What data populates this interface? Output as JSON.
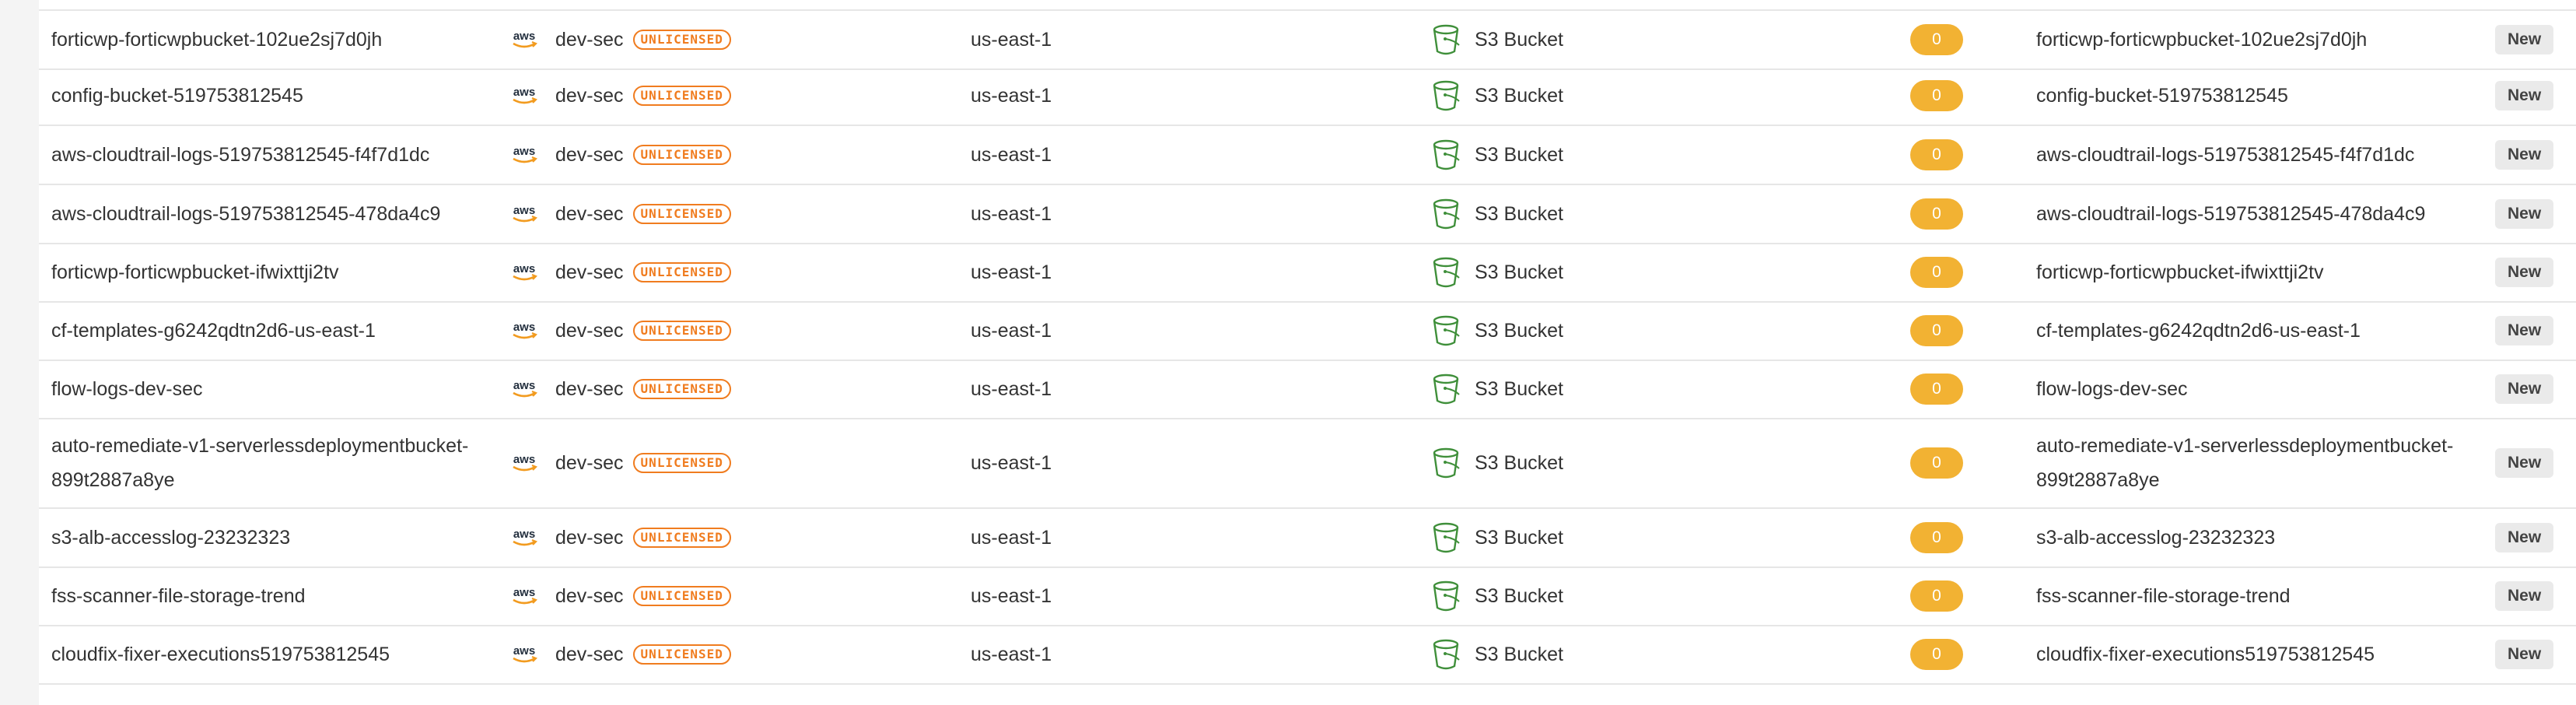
{
  "rows": [
    {
      "name": "forticwp-forticwpbucket-102ue2sj7d0jh",
      "provider_icon": "aws-logo-icon",
      "account": "dev-sec",
      "license": "UNLICENSED",
      "region": "us-east-1",
      "type": "S3 Bucket",
      "type_icon": "s3-bucket-icon",
      "count": "0",
      "resource": "forticwp-forticwpbucket-102ue2sj7d0jh",
      "status": "New"
    },
    {
      "name": "config-bucket-519753812545",
      "provider_icon": "aws-logo-icon",
      "account": "dev-sec",
      "license": "UNLICENSED",
      "region": "us-east-1",
      "type": "S3 Bucket",
      "type_icon": "s3-bucket-icon",
      "count": "0",
      "resource": "config-bucket-519753812545",
      "status": "New"
    },
    {
      "name": "aws-cloudtrail-logs-519753812545-f4f7d1dc",
      "provider_icon": "aws-logo-icon",
      "account": "dev-sec",
      "license": "UNLICENSED",
      "region": "us-east-1",
      "type": "S3 Bucket",
      "type_icon": "s3-bucket-icon",
      "count": "0",
      "resource": "aws-cloudtrail-logs-519753812545-f4f7d1dc",
      "status": "New"
    },
    {
      "name": "aws-cloudtrail-logs-519753812545-478da4c9",
      "provider_icon": "aws-logo-icon",
      "account": "dev-sec",
      "license": "UNLICENSED",
      "region": "us-east-1",
      "type": "S3 Bucket",
      "type_icon": "s3-bucket-icon",
      "count": "0",
      "resource": "aws-cloudtrail-logs-519753812545-478da4c9",
      "status": "New"
    },
    {
      "name": "forticwp-forticwpbucket-ifwixttji2tv",
      "provider_icon": "aws-logo-icon",
      "account": "dev-sec",
      "license": "UNLICENSED",
      "region": "us-east-1",
      "type": "S3 Bucket",
      "type_icon": "s3-bucket-icon",
      "count": "0",
      "resource": "forticwp-forticwpbucket-ifwixttji2tv",
      "status": "New"
    },
    {
      "name": "cf-templates-g6242qdtn2d6-us-east-1",
      "provider_icon": "aws-logo-icon",
      "account": "dev-sec",
      "license": "UNLICENSED",
      "region": "us-east-1",
      "type": "S3 Bucket",
      "type_icon": "s3-bucket-icon",
      "count": "0",
      "resource": "cf-templates-g6242qdtn2d6-us-east-1",
      "status": "New"
    },
    {
      "name": "flow-logs-dev-sec",
      "provider_icon": "aws-logo-icon",
      "account": "dev-sec",
      "license": "UNLICENSED",
      "region": "us-east-1",
      "type": "S3 Bucket",
      "type_icon": "s3-bucket-icon",
      "count": "0",
      "resource": "flow-logs-dev-sec",
      "status": "New"
    },
    {
      "name": "auto-remediate-v1-serverlessdeploymentbucket-899t2887a8ye",
      "provider_icon": "aws-logo-icon",
      "account": "dev-sec",
      "license": "UNLICENSED",
      "region": "us-east-1",
      "type": "S3 Bucket",
      "type_icon": "s3-bucket-icon",
      "count": "0",
      "resource": "auto-remediate-v1-serverlessdeploymentbucket-899t2887a8ye",
      "status": "New"
    },
    {
      "name": "s3-alb-accesslog-23232323",
      "provider_icon": "aws-logo-icon",
      "account": "dev-sec",
      "license": "UNLICENSED",
      "region": "us-east-1",
      "type": "S3 Bucket",
      "type_icon": "s3-bucket-icon",
      "count": "0",
      "resource": "s3-alb-accesslog-23232323",
      "status": "New"
    },
    {
      "name": "fss-scanner-file-storage-trend",
      "provider_icon": "aws-logo-icon",
      "account": "dev-sec",
      "license": "UNLICENSED",
      "region": "us-east-1",
      "type": "S3 Bucket",
      "type_icon": "s3-bucket-icon",
      "count": "0",
      "resource": "fss-scanner-file-storage-trend",
      "status": "New"
    },
    {
      "name": "cloudfix-fixer-executions519753812545",
      "provider_icon": "aws-logo-icon",
      "account": "dev-sec",
      "license": "UNLICENSED",
      "region": "us-east-1",
      "type": "S3 Bucket",
      "type_icon": "s3-bucket-icon",
      "count": "0",
      "resource": "cloudfix-fixer-executions519753812545",
      "status": "New"
    }
  ],
  "colors": {
    "license_badge": "#f07c1f",
    "count_pill": "#f2b233",
    "bucket_icon": "#3f8f3a",
    "status_badge_bg": "#eaeaea"
  }
}
